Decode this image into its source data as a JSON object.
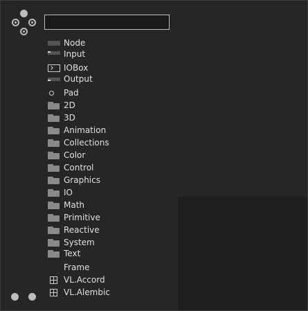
{
  "search": {
    "value": "",
    "placeholder": ""
  },
  "nav_icon": "directional-pad-icon",
  "items": [
    {
      "label": "Node",
      "icon": "node-icon"
    },
    {
      "label": "Input",
      "icon": "input-pin-icon"
    },
    {
      "label": "IOBox",
      "icon": "iobox-icon"
    },
    {
      "label": "Output",
      "icon": "output-pin-icon"
    },
    {
      "label": "Pad",
      "icon": "pad-circle-icon"
    },
    {
      "label": "2D",
      "icon": "folder-icon"
    },
    {
      "label": "3D",
      "icon": "folder-icon"
    },
    {
      "label": "Animation",
      "icon": "folder-icon"
    },
    {
      "label": "Collections",
      "icon": "folder-icon"
    },
    {
      "label": "Color",
      "icon": "folder-icon"
    },
    {
      "label": "Control",
      "icon": "folder-icon"
    },
    {
      "label": "Graphics",
      "icon": "folder-icon"
    },
    {
      "label": "IO",
      "icon": "folder-icon"
    },
    {
      "label": "Math",
      "icon": "folder-icon"
    },
    {
      "label": "Primitive",
      "icon": "folder-icon"
    },
    {
      "label": "Reactive",
      "icon": "folder-icon"
    },
    {
      "label": "System",
      "icon": "folder-icon"
    },
    {
      "label": "Text",
      "icon": "folder-icon"
    },
    {
      "label": "Frame",
      "icon": ""
    },
    {
      "label": "VL.Accord",
      "icon": "package-icon"
    },
    {
      "label": "VL.Alembic",
      "icon": "package-icon"
    }
  ],
  "colors": {
    "background": "#262626",
    "text": "#e0e0e0",
    "icon": "#8a8a8a"
  }
}
